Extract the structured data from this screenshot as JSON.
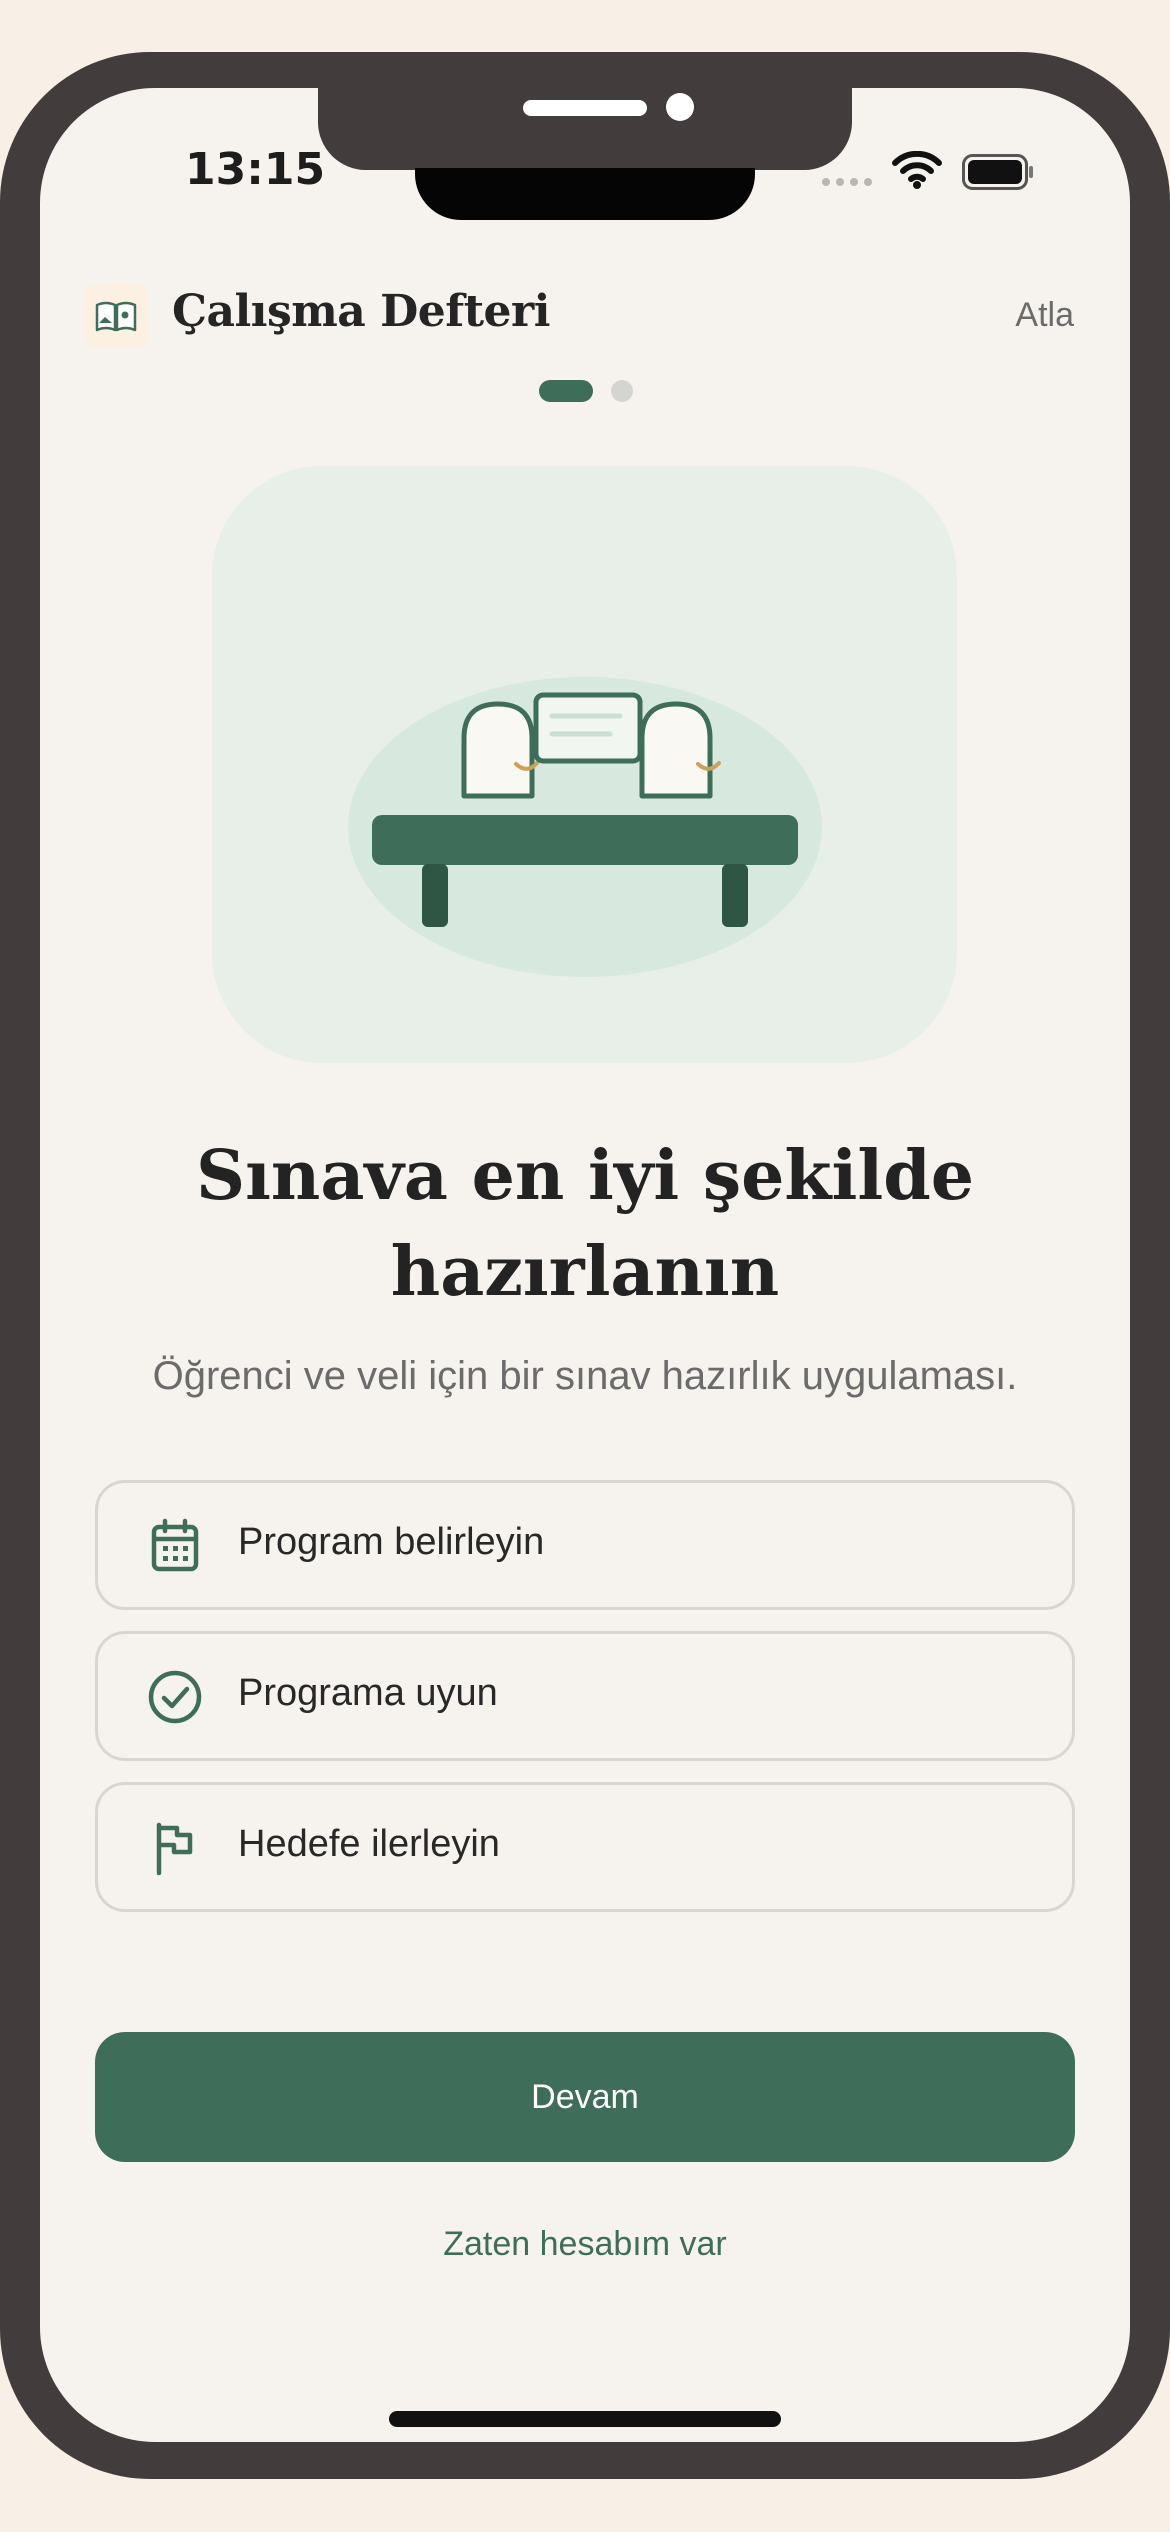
{
  "status_bar": {
    "time": "13:15"
  },
  "header": {
    "app_title": "Çalışma Defteri",
    "skip_label": "Atla",
    "logo_icon": "open-book-icon"
  },
  "pager": {
    "current": 1,
    "total": 2
  },
  "hero": {
    "illustration": "study-desk-with-books"
  },
  "content": {
    "headline_line1": "Sınava en iyi şekilde",
    "headline_line2": "hazırlanın",
    "subtitle": "Öğrenci ve veli için bir sınav hazırlık uygulaması."
  },
  "features": [
    {
      "icon": "calendar-icon",
      "label": "Program belirleyin"
    },
    {
      "icon": "check-circle-icon",
      "label": "Programa uyun"
    },
    {
      "icon": "flag-icon",
      "label": "Hedefe ilerleyin"
    }
  ],
  "actions": {
    "primary_label": "Devam",
    "secondary_label": "Zaten hesabım var"
  },
  "colors": {
    "accent": "#3e6e5a",
    "background": "#f6f3ee",
    "frame": "#423d3c"
  }
}
